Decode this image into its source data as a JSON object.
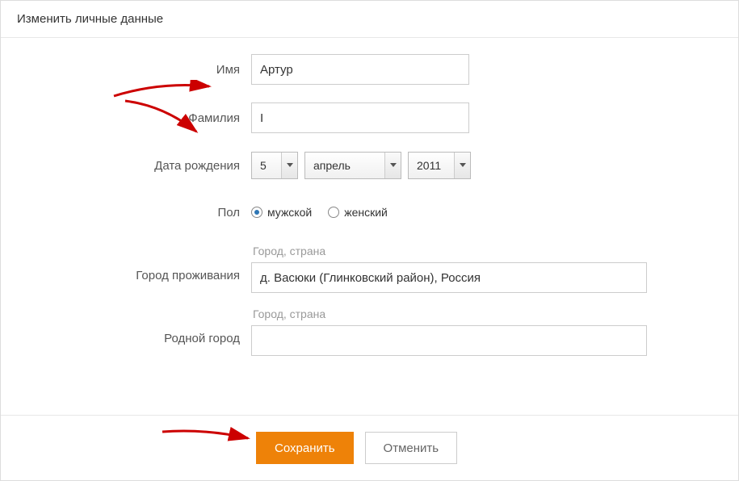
{
  "dialog": {
    "title": "Изменить личные данные"
  },
  "labels": {
    "first_name": "Имя",
    "last_name": "Фамилия",
    "birth_date": "Дата рождения",
    "gender": "Пол",
    "city_residence": "Город проживания",
    "hometown": "Родной город"
  },
  "values": {
    "first_name": "Артур",
    "last_name": "I",
    "birth_day": "5",
    "birth_month": "апрель",
    "birth_year": "2011",
    "city_residence": "д. Васюки (Глинковский район), Россия",
    "hometown": ""
  },
  "gender": {
    "male": "мужской",
    "female": "женский",
    "selected": "male"
  },
  "helpers": {
    "city_country": "Город, страна"
  },
  "buttons": {
    "save": "Сохранить",
    "cancel": "Отменить"
  }
}
